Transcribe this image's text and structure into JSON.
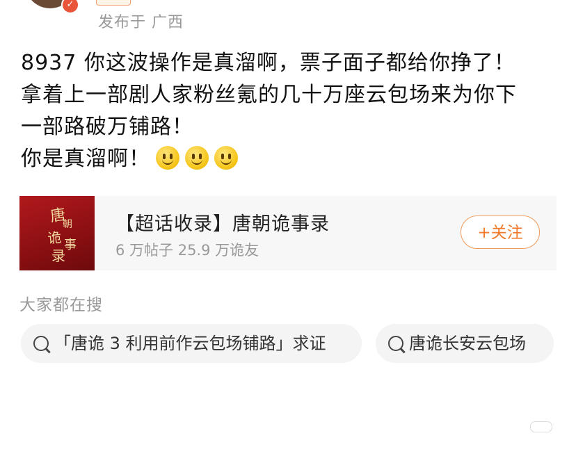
{
  "header": {
    "location": "发布于 广西"
  },
  "post": {
    "lines": [
      "8937 你这波操作是真溜啊，票子面子都给你挣了！",
      "拿着上一部剧人家粉丝氪的几十万座云包场来为你下",
      "一部路破万铺路！",
      "你是真溜啊！"
    ],
    "emoji_count": 3
  },
  "topic_card": {
    "thumbnail_icon": "tang-chao-gui-shi-lu-poster-icon",
    "thumbnail_text": [
      "唐",
      "朝",
      "诡",
      "事",
      "录"
    ],
    "title": "【超话收录】唐朝诡事录",
    "stats": "6 万帖子  25.9 万诡友",
    "follow_label": "+关注"
  },
  "search": {
    "heading": "大家都在搜",
    "chips": [
      "「唐诡 3 利用前作云包场铺路」求证",
      "唐诡长安云包场"
    ]
  },
  "colors": {
    "accent_orange": "#f07a2a",
    "meta_gray": "#999999",
    "card_bg": "#f7f7f7",
    "thumb_red": "#b1191c"
  }
}
